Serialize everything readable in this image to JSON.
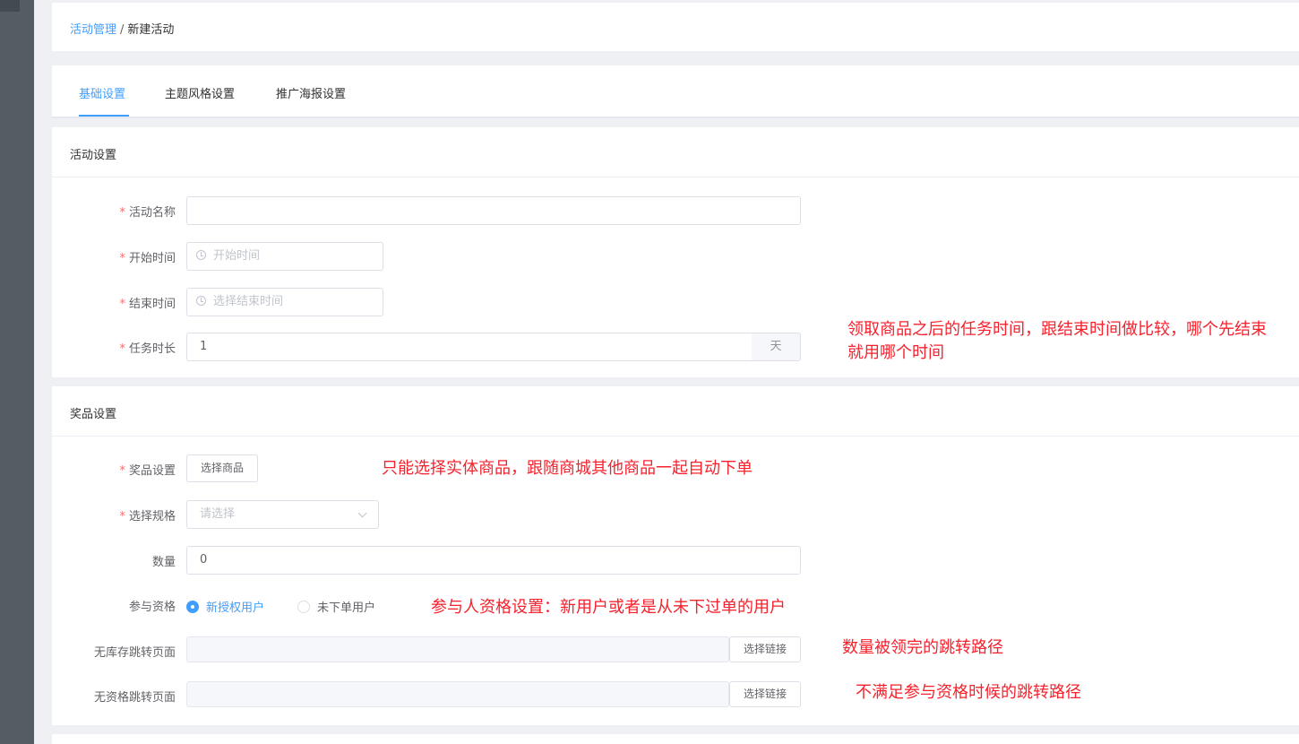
{
  "breadcrumb": {
    "parent": "活动管理",
    "separator": "/",
    "current": "新建活动"
  },
  "tabs": [
    {
      "label": "基础设置",
      "active": true
    },
    {
      "label": "主题风格设置",
      "active": false
    },
    {
      "label": "推广海报设置",
      "active": false
    }
  ],
  "activity_section": {
    "title": "活动设置",
    "name_label": "活动名称",
    "name_value": "",
    "start_label": "开始时间",
    "start_placeholder": "开始时间",
    "end_label": "结束时间",
    "end_placeholder": "选择结束时间",
    "duration_label": "任务时长",
    "duration_value": "1",
    "duration_unit": "天"
  },
  "prize_section": {
    "title": "奖品设置",
    "prize_label": "奖品设置",
    "select_goods_button": "选择商品",
    "spec_label": "选择规格",
    "spec_placeholder": "请选择",
    "quantity_label": "数量",
    "quantity_value": "0",
    "eligibility_label": "参与资格",
    "eligibility_options": [
      {
        "label": "新授权用户",
        "selected": true
      },
      {
        "label": "未下单用户",
        "selected": false
      }
    ],
    "no_stock_label": "无库存跳转页面",
    "no_stock_button": "选择链接",
    "no_qual_label": "无资格跳转页面",
    "no_qual_button": "选择链接"
  },
  "annotations": {
    "duration_note_line1": "领取商品之后的任务时间，跟结束时间做比较，哪个先结束",
    "duration_note_line2": "就用哪个时间",
    "goods_note": "只能选择实体商品，跟随商城其他商品一起自动下单",
    "eligibility_note": "参与人资格设置：新用户或者是从未下过单的用户",
    "no_stock_note": "数量被领完的跳转路径",
    "no_qual_note": "不满足参与资格时候的跳转路径"
  },
  "colors": {
    "primary": "#409eff",
    "required": "#f56c6c",
    "annotation": "#f5222d",
    "sidebar": "#545c64"
  }
}
